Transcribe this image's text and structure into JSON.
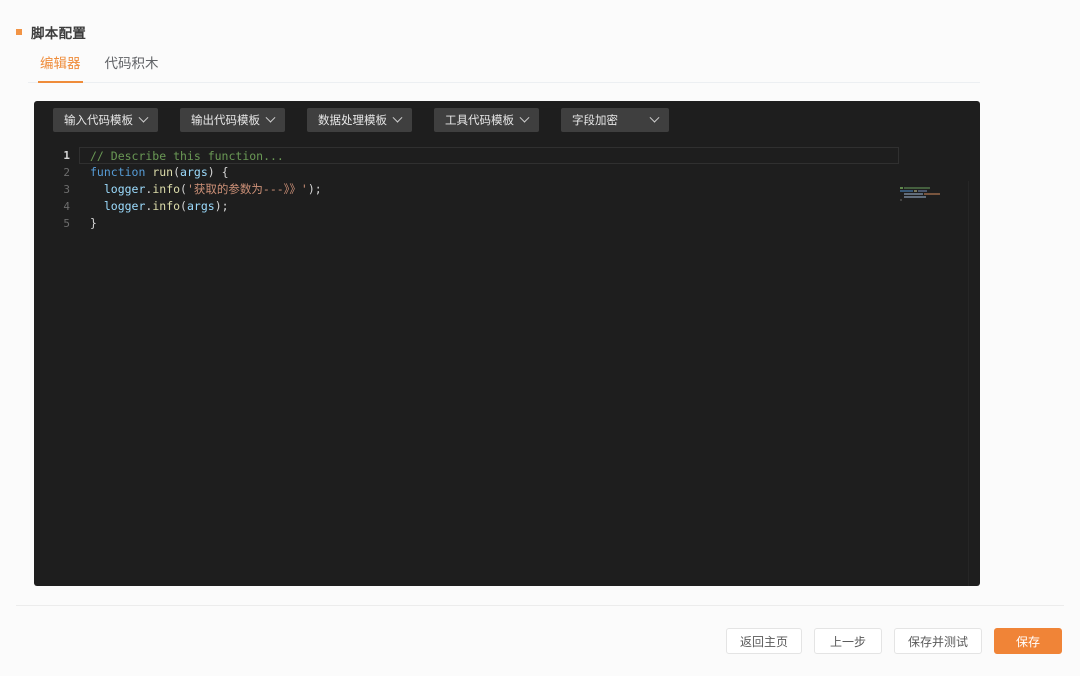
{
  "section": {
    "title": "脚本配置",
    "bullet_color": "#f29445"
  },
  "tabs": [
    {
      "label": "编辑器",
      "active": true
    },
    {
      "label": "代码积木",
      "active": false
    }
  ],
  "editor": {
    "template_buttons": [
      {
        "label": "输入代码模板",
        "icon": "chevron-down-icon"
      },
      {
        "label": "输出代码模板",
        "icon": "chevron-down-icon"
      },
      {
        "label": "数据处理模板",
        "icon": "chevron-down-icon"
      },
      {
        "label": "工具代码模板",
        "icon": "chevron-down-icon"
      },
      {
        "label": "字段加密",
        "icon": "chevron-down-icon"
      }
    ],
    "line_numbers": [
      "1",
      "2",
      "3",
      "4",
      "5"
    ],
    "active_line": 1,
    "code": [
      "// Describe this function...",
      "function run(args) {",
      "  logger.info('获取的参数为---》》');",
      "  logger.info(args);",
      "}"
    ],
    "theme": {
      "background": "#1e1e1e",
      "comment": "#6a9955",
      "keyword": "#569cd6",
      "function": "#dcdcaa",
      "variable": "#9cdcfe",
      "string": "#ce9178",
      "plain": "#d4d4d4",
      "toolbar_button": "#3f3f3f"
    }
  },
  "footer": {
    "buttons": [
      {
        "label": "返回主页",
        "primary": false
      },
      {
        "label": "上一步",
        "primary": false
      },
      {
        "label": "保存并测试",
        "primary": false
      },
      {
        "label": "保存",
        "primary": true
      }
    ],
    "primary_color": "#f08437"
  }
}
